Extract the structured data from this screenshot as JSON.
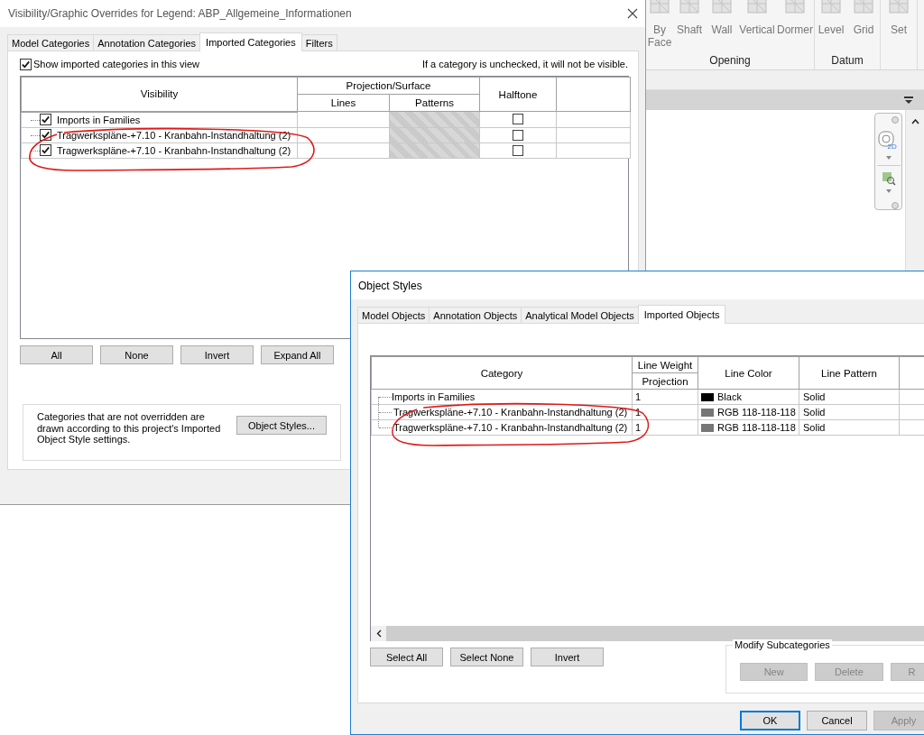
{
  "ribbon": {
    "groups": [
      {
        "label": "Opening",
        "tools": [
          "By Face",
          "Shaft",
          "Wall",
          "Vertical",
          "Dormer"
        ]
      },
      {
        "label": "Datum",
        "tools": [
          "Level",
          "Grid"
        ]
      },
      {
        "tools": [
          "Set"
        ]
      }
    ]
  },
  "navigation_bar": {
    "wheel_label": "2D"
  },
  "visibility_dialog": {
    "title": "Visibility/Graphic Overrides for Legend: ABP_Allgemeine_Informationen",
    "tabs": [
      {
        "label": "Model Categories",
        "selected": false
      },
      {
        "label": "Annotation Categories",
        "selected": false
      },
      {
        "label": "Imported Categories",
        "selected": true
      },
      {
        "label": "Filters",
        "selected": false
      }
    ],
    "show_imported": {
      "label": "Show imported categories in this view",
      "checked": true
    },
    "hint": "If a category is unchecked, it will not be visible.",
    "columns": {
      "visibility": "Visibility",
      "projection_surface": "Projection/Surface",
      "lines": "Lines",
      "patterns": "Patterns",
      "halftone": "Halftone"
    },
    "rows": [
      {
        "name": "Imports in Families",
        "checked": true,
        "halftone": false
      },
      {
        "name": "Tragwerkspläne-+7.10 - Kranbahn-Instandhaltung (2)",
        "checked": true,
        "halftone": false
      },
      {
        "name": "Tragwerkspläne-+7.10 - Kranbahn-Instandhaltung (2)",
        "checked": true,
        "halftone": false
      }
    ],
    "buttons": [
      "All",
      "None",
      "Invert",
      "Expand All"
    ],
    "note": "Categories that are not overridden are drawn according to this project's Imported Object Style settings.",
    "object_styles_button": "Object Styles..."
  },
  "object_styles_dialog": {
    "title": "Object Styles",
    "tabs": [
      {
        "label": "Model Objects",
        "selected": false
      },
      {
        "label": "Annotation Objects",
        "selected": false
      },
      {
        "label": "Analytical Model Objects",
        "selected": false
      },
      {
        "label": "Imported Objects",
        "selected": true
      }
    ],
    "columns": {
      "category": "Category",
      "line_weight": "Line Weight",
      "projection": "Projection",
      "line_color": "Line Color",
      "line_pattern": "Line Pattern"
    },
    "rows": [
      {
        "name": "Imports in Families",
        "line_weight": "1",
        "line_color": "Black",
        "color": "#000000",
        "line_pattern": "Solid"
      },
      {
        "name": "Tragwerkspläne-+7.10 - Kranbahn-Instandhaltung (2)",
        "line_weight": "1",
        "line_color": "RGB 118-118-118",
        "color": "#767676",
        "line_pattern": "Solid"
      },
      {
        "name": "Tragwerkspläne-+7.10 - Kranbahn-Instandhaltung (2)",
        "line_weight": "1",
        "line_color": "RGB 118-118-118",
        "color": "#767676",
        "line_pattern": "Solid"
      }
    ],
    "buttons": [
      "Select All",
      "Select None",
      "Invert"
    ],
    "modify_subcategories": {
      "title": "Modify Subcategories",
      "buttons": [
        {
          "label": "New",
          "disabled": true
        },
        {
          "label": "Delete",
          "disabled": true
        },
        {
          "label": "R",
          "disabled": true
        }
      ]
    },
    "footer_buttons": [
      {
        "label": "OK",
        "default": true,
        "disabled": false
      },
      {
        "label": "Cancel",
        "default": false,
        "disabled": false
      },
      {
        "label": "Apply",
        "default": false,
        "disabled": true
      }
    ]
  }
}
